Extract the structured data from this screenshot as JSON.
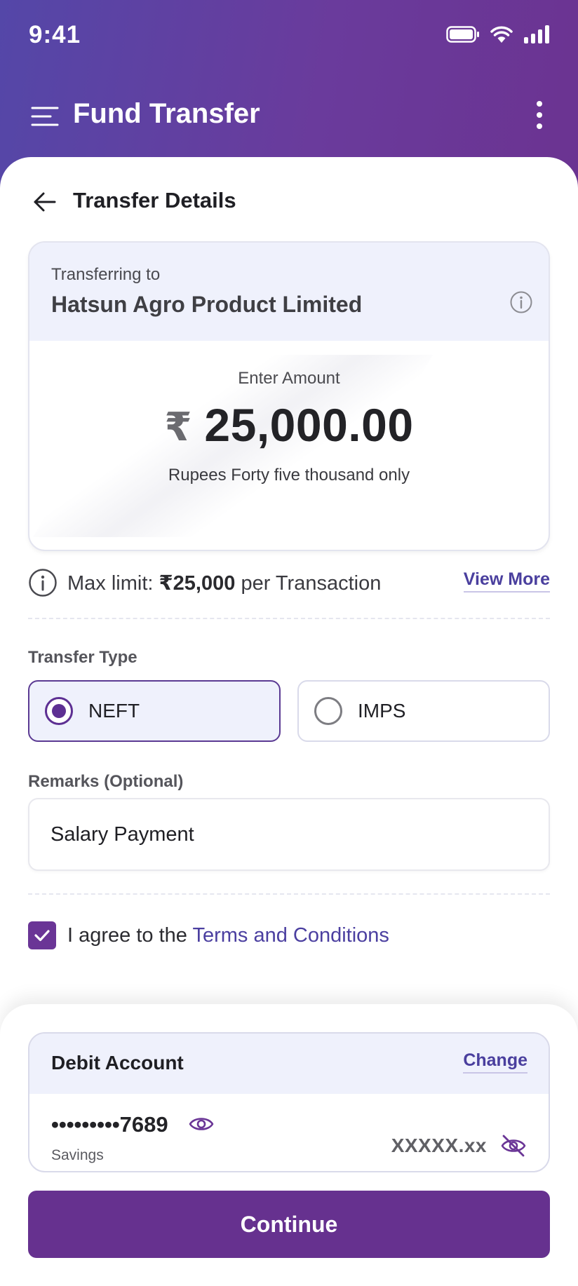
{
  "status_bar": {
    "time": "9:41"
  },
  "appbar": {
    "title": "Fund Transfer"
  },
  "section": {
    "title": "Transfer Details"
  },
  "transfer": {
    "to_label": "Transferring to",
    "payee_name": "Hatsun Agro Product Limited",
    "amount_label": "Enter Amount",
    "currency_symbol": "₹",
    "amount": "25,000.00",
    "amount_in_words": "Rupees Forty five thousand only"
  },
  "limit": {
    "prefix": "Max limit: ",
    "value": "₹25,000",
    "suffix": " per Transaction",
    "view_more": "View More"
  },
  "transfer_type": {
    "label": "Transfer Type",
    "options": [
      {
        "label": "NEFT",
        "selected": true
      },
      {
        "label": "IMPS",
        "selected": false
      }
    ]
  },
  "remarks": {
    "label": "Remarks (Optional)",
    "value": "Salary Payment"
  },
  "agreement": {
    "prefix": "I agree to the ",
    "link": "Terms and Conditions",
    "checked": true
  },
  "debit_account": {
    "title": "Debit Account",
    "change": "Change",
    "masked_number": "•••••••••7689",
    "type": "Savings",
    "balance": "XXXXX.xx"
  },
  "continue_label": "Continue",
  "colors": {
    "brand_purple": "#66318f",
    "header_gradient_start": "#5447a8",
    "header_gradient_end": "#6b3391",
    "card_tint": "#eff1fc",
    "link": "#4a3f9e"
  },
  "icons": [
    "hamburger-icon",
    "kebab-icon",
    "back-arrow-icon",
    "info-icon",
    "eye-icon",
    "eye-off-icon",
    "check-icon",
    "wifi-icon",
    "battery-icon",
    "signal-icon"
  ]
}
